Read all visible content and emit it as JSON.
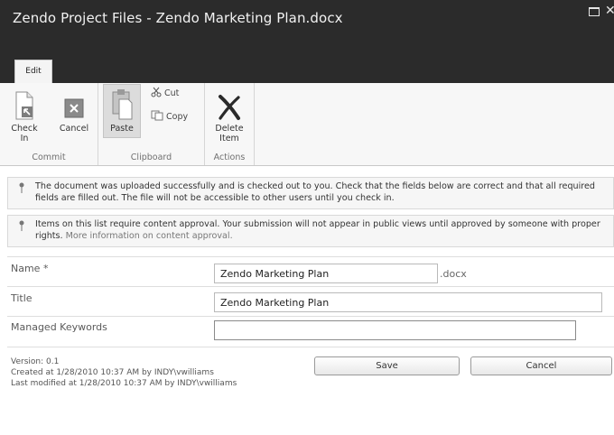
{
  "window": {
    "title": "Zendo Project Files - Zendo Marketing Plan.docx"
  },
  "tabs": [
    {
      "label": "Edit"
    }
  ],
  "ribbon": {
    "commit": {
      "label": "Commit",
      "check_in": {
        "line1": "Check",
        "line2": "In"
      },
      "cancel": "Cancel"
    },
    "clipboard": {
      "label": "Clipboard",
      "paste": "Paste",
      "cut": "Cut",
      "copy": "Copy"
    },
    "actions": {
      "label": "Actions",
      "delete": {
        "line1": "Delete",
        "line2": "Item"
      }
    }
  },
  "notices": [
    {
      "text": "The document was uploaded successfully and is checked out to you. Check that the fields below are correct and that all required fields are filled out. The file will not be accessible to other users until you check in."
    },
    {
      "text": "Items on this list require content approval. Your submission will not appear in public views until approved by someone with proper rights.",
      "link": "More information on content approval."
    }
  ],
  "form": {
    "name": {
      "label": "Name *",
      "value": "Zendo Marketing Plan",
      "extension": ".docx"
    },
    "title": {
      "label": "Title",
      "value": "Zendo Marketing Plan"
    },
    "keywords": {
      "label": "Managed Keywords",
      "value": ""
    }
  },
  "footer": {
    "version": "Version: 0.1",
    "created": "Created at 1/28/2010 10:37 AM by INDY\\vwilliams",
    "modified": "Last modified at 1/28/2010 10:37 AM by INDY\\vwilliams",
    "save": "Save",
    "cancel": "Cancel"
  },
  "colors": {
    "title_bar": "#2b2b2b",
    "ribbon": "#f7f7f7",
    "notice_bg": "#f6f6f6"
  }
}
